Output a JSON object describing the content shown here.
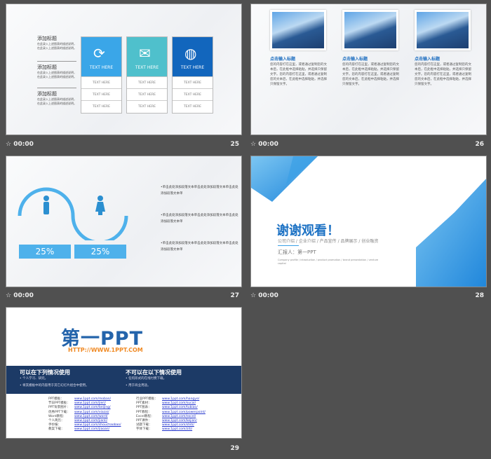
{
  "slides": [
    {
      "number": "25",
      "time": "00:00",
      "side_items": [
        {
          "title": "添加标题",
          "text": "在此录入上述图表的描述说明，在此录入上述图表的描述说明。"
        },
        {
          "title": "添加标题",
          "text": "在此录入上述图表的描述说明，在此录入上述图表的描述说明。"
        },
        {
          "title": "添加标题",
          "text": "在此录入上述图表的描述说明，在此录入上述图表的描述说明。"
        }
      ],
      "cards": [
        {
          "icon": "refresh-icon",
          "color": "#3aa6e8",
          "label": "TEXT HERE",
          "rows": [
            "TEXT HERE",
            "TEXT HERE",
            "TEXT HERE"
          ]
        },
        {
          "icon": "mail-icon",
          "color": "#4fc0cc",
          "label": "TEXT HERE",
          "rows": [
            "TEXT HERE",
            "TEXT HERE",
            "TEXT HERE"
          ]
        },
        {
          "icon": "globe-icon",
          "color": "#1266bd",
          "label": "TEXT HERE",
          "rows": [
            "TEXT HERE",
            "TEXT HERE",
            "TEXT HERE"
          ]
        }
      ]
    },
    {
      "number": "26",
      "time": "00:00",
      "items": [
        {
          "title": "点击输入标题",
          "text": "您的内容打在这里，或者通过复制您的文本后，在此框中选择粘贴，并选择只保留文字。您的内容打在这里，或者通过复制您的文本后，在此框中选择粘贴，并选择只保留文字。"
        },
        {
          "title": "点击输入标题",
          "text": "您的内容打在这里，或者通过复制您的文本后，在此框中选择粘贴，并选择只保留文字。您的内容打在这里，或者通过复制您的文本后，在此框中选择粘贴，并选择只保留文字。"
        },
        {
          "title": "点击输入标题",
          "text": "您的内容打在这里，或者通过复制您的文本后，在此框中选择粘贴，并选择只保留文字。您的内容打在这里，或者通过复制您的文本后，在此框中选择粘贴，并选择只保留文字。"
        }
      ]
    },
    {
      "number": "27",
      "time": "00:00",
      "percents": [
        "25%",
        "25%"
      ],
      "bullets": [
        "•单击此处添加段落文本单击此处添加段落文本单击此处添加段落文本单",
        "•单击此处添加段落文本单击此处添加段落文本单击此处添加段落文本单",
        "•单击此处添加段落文本单击此处添加段落文本单击此处添加段落文本单"
      ]
    },
    {
      "number": "28",
      "time": "00:00",
      "title": "谢谢观看！",
      "subtitle": "公司介绍 / 企业介绍 / 产品宣传 / 品牌展示 / 创业融资",
      "reporter": "汇报人：第一PPT",
      "english": "Company profile / introduction / product promotion / brand presentation / venture capital"
    },
    {
      "number": "29",
      "logo": "第一PPT",
      "url": "HTTP://WWW.1PPT.COM",
      "can_title": "可以在下列情况使用",
      "can": [
        "• 个人学习、研究。",
        "• 将其模板中的内容用于其它幻灯片组合中使用。"
      ],
      "cannot_title": "不可以在以下情况使用",
      "cannot": [
        "• 任何形式的在线付费下载。",
        "• 用于商业用途。"
      ],
      "links_left": [
        [
          "PPT模板：",
          "www.1ppt.com/moban/"
        ],
        [
          "节日PPT模板：",
          "www.1ppt.com/jieri/"
        ],
        [
          "PPT背景图片：",
          "www.1ppt.com/beijing/"
        ],
        [
          "优秀PPT下载：",
          "www.1ppt.com/xiazai/"
        ],
        [
          "Word教程：",
          "www.1ppt.com/word/"
        ],
        [
          "个人简历：",
          "www.1ppt.com/jianli/"
        ],
        [
          "手抄报：",
          "www.1ppt.com/shouchaobao/"
        ],
        [
          "教案下载：",
          "www.1ppt.com/jiaoan/"
        ]
      ],
      "links_right": [
        [
          "行业PPT模板：",
          "www.1ppt.com/hangye/"
        ],
        [
          "PPT素材：",
          "www.1ppt.com/sucai/"
        ],
        [
          "PPT图表：",
          "www.1ppt.com/tubiao/"
        ],
        [
          "PPT教程：",
          "www.1ppt.com/powerpoint/"
        ],
        [
          "Excel教程：",
          "www.1ppt.com/excel/"
        ],
        [
          "PPT课件：",
          "www.1ppt.com/kejian/"
        ],
        [
          "试题下载：",
          "www.1ppt.com/shiti/"
        ],
        [
          "字体下载：",
          "www.1ppt.com/ziti/"
        ]
      ]
    }
  ]
}
